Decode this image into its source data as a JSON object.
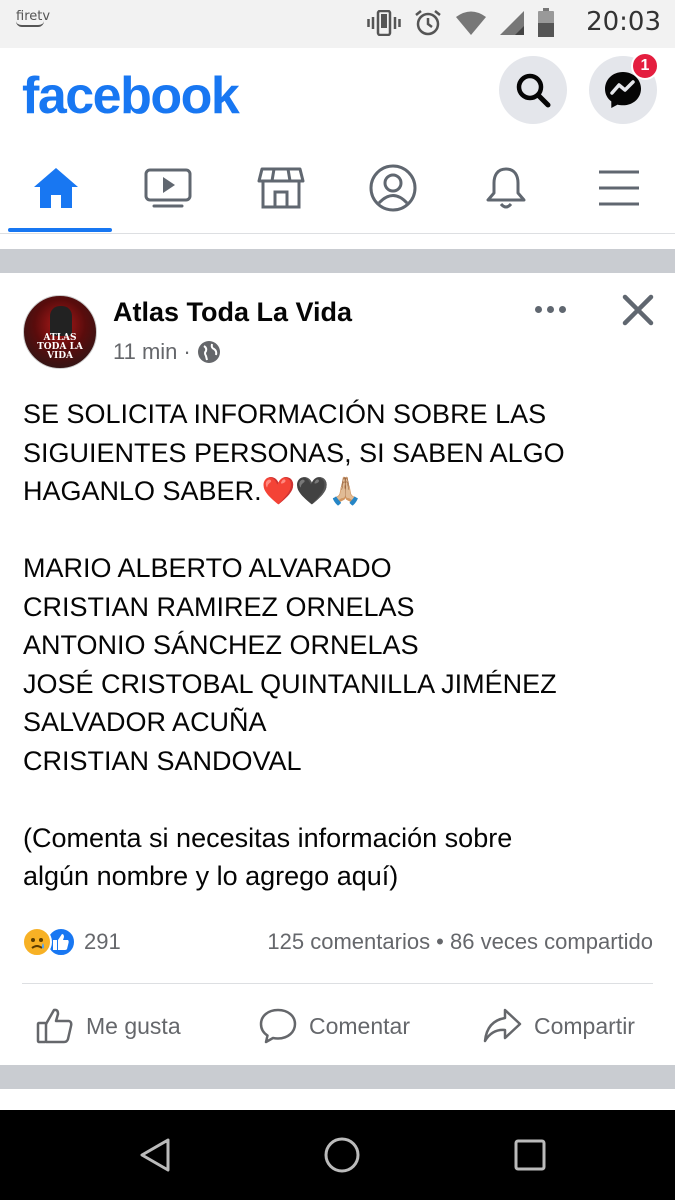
{
  "status_bar": {
    "brand": "firetv",
    "time": "20:03",
    "icons": [
      "vibrate-icon",
      "alarm-icon",
      "wifi-icon",
      "signal-icon",
      "battery-icon"
    ]
  },
  "header": {
    "logo": "facebook",
    "messenger_badge": "1",
    "brand_color": "#1877f2"
  },
  "tabs": [
    {
      "name": "home",
      "icon": "home-icon",
      "active": true
    },
    {
      "name": "watch",
      "icon": "video-icon",
      "active": false
    },
    {
      "name": "marketplace",
      "icon": "store-icon",
      "active": false
    },
    {
      "name": "profile",
      "icon": "profile-icon",
      "active": false
    },
    {
      "name": "notifications",
      "icon": "bell-icon",
      "active": false
    },
    {
      "name": "menu",
      "icon": "menu-icon",
      "active": false
    }
  ],
  "post": {
    "author": "Atlas Toda La Vida",
    "avatar_text": [
      "ATLAS",
      "TODA LA",
      "VIDA"
    ],
    "time": "11 min",
    "separator": "·",
    "privacy_icon": "globe-icon",
    "lines": [
      "SE SOLICITA INFORMACIÓN SOBRE LAS",
      "SIGUIENTES PERSONAS, SI SABEN ALGO",
      "HAGANLO SABER.❤️🖤🙏🏼",
      "",
      "MARIO ALBERTO ALVARADO",
      "CRISTIAN RAMIREZ ORNELAS",
      "ANTONIO SÁNCHEZ ORNELAS",
      "JOSÉ CRISTOBAL QUINTANILLA JIMÉNEZ",
      "SALVADOR ACUÑA",
      "CRISTIAN SANDOVAL",
      "",
      "(Comenta si necesitas información sobre",
      "algún nombre y lo agrego aquí)"
    ],
    "reaction_count": "291",
    "reaction_icons": [
      "sad-reaction-icon",
      "like-reaction-icon"
    ],
    "comments_shares": "125 comentarios • 86 veces compartido",
    "actions": {
      "like": "Me gusta",
      "comment": "Comentar",
      "share": "Compartir"
    }
  },
  "nav_bar": [
    "back-icon",
    "home-circle-icon",
    "recents-icon"
  ]
}
